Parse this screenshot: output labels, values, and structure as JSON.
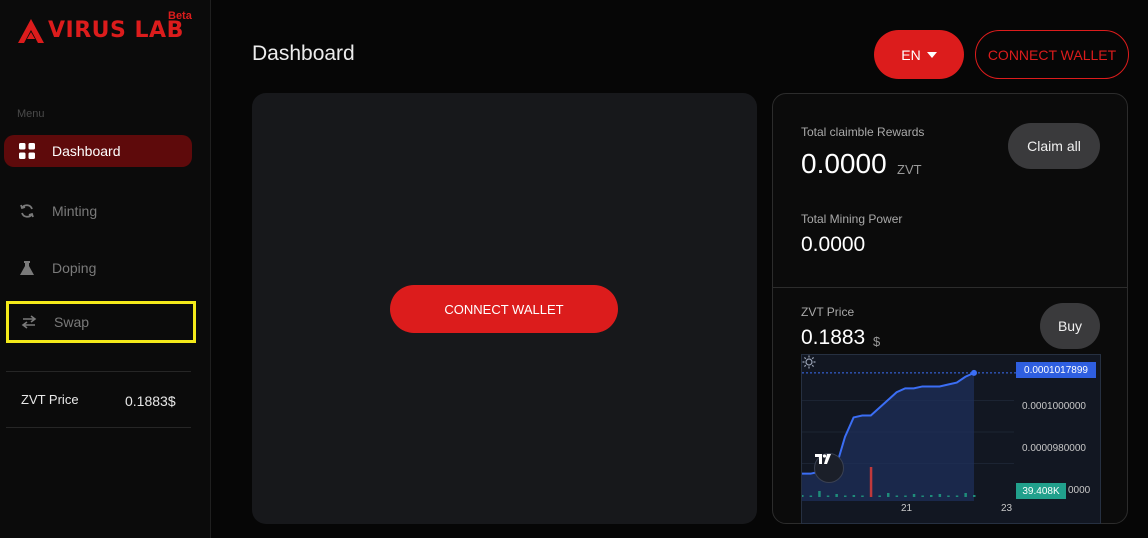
{
  "brand": {
    "name": "VIRUS LAB",
    "badge": "Beta"
  },
  "sidebar": {
    "menu_label": "Menu",
    "items": [
      {
        "label": "Dashboard",
        "icon": "grid-icon",
        "active": true
      },
      {
        "label": "Minting",
        "icon": "refresh-icon"
      },
      {
        "label": "Doping",
        "icon": "flask-icon"
      },
      {
        "label": "Swap",
        "icon": "swap-icon"
      }
    ],
    "price_label": "ZVT Price",
    "price_value": "0.1883$"
  },
  "header": {
    "title": "Dashboard",
    "lang": "EN",
    "connect_label": "CONNECT WALLET"
  },
  "main": {
    "connect_label": "CONNECT WALLET"
  },
  "rewards": {
    "claimable_label": "Total claimble Rewards",
    "claimable_value": "0.0000",
    "claimable_unit": "ZVT",
    "claim_button": "Claim all",
    "mining_label": "Total Mining Power",
    "mining_value": "0.0000"
  },
  "price": {
    "label": "ZVT Price",
    "value": "0.1883",
    "unit": "$",
    "buy_button": "Buy"
  },
  "chart_data": {
    "type": "line",
    "title": "",
    "y_tick_labels": [
      "0.0001000000",
      "0.0000980000",
      "0000"
    ],
    "current_price_label": "0.0001017899",
    "volume_label": "39.408K",
    "x_tick_labels": [
      "21",
      "23"
    ],
    "x": [
      0,
      5,
      10,
      15,
      20,
      25,
      30,
      35,
      40,
      45,
      50,
      55,
      60,
      65,
      70,
      75,
      80,
      85,
      90,
      95,
      100
    ],
    "values": [
      9.66e-05,
      9.66e-05,
      9.67e-05,
      9.68e-05,
      9.7e-05,
      9.85e-05,
      9.95e-05,
      9.96e-05,
      9.96e-05,
      0.0001,
      0.0001004,
      0.0001008,
      0.000101,
      0.000101,
      0.0001011,
      0.0001011,
      0.0001011,
      0.0001012,
      0.0001013,
      0.0001016,
      0.0001018
    ],
    "volume": [
      2,
      1,
      6,
      1,
      3,
      1,
      2,
      1,
      30,
      1,
      4,
      1,
      1,
      3,
      1,
      2,
      3,
      1,
      1,
      4,
      2
    ],
    "colors": {
      "line": "#3b6ef5",
      "area": "#1e2f5a",
      "volume_up": "#1f8c7a",
      "volume_down": "#c0393b"
    }
  },
  "colors": {
    "accent": "#dc1c1c",
    "highlight": "#f4ea1a"
  }
}
